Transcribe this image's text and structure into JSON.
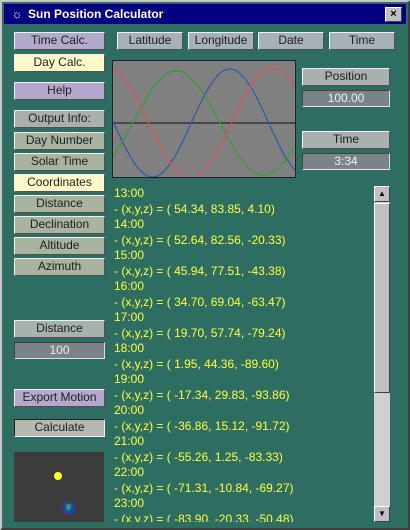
{
  "window": {
    "title": "Sun Position Calculator",
    "close_glyph": "×"
  },
  "left_menu": {
    "time_calc": "Time Calc.",
    "day_calc": "Day Calc.",
    "help": "Help",
    "output_info": "Output Info:",
    "items": [
      "Day Number",
      "Solar Time",
      "Coordinates",
      "Distance",
      "Declination",
      "Altitude",
      "Azimuth"
    ],
    "selected_item": "Coordinates",
    "distance_label": "Distance",
    "distance_value": "100",
    "export_motion": "Export Motion",
    "calculate": "Calculate"
  },
  "top_buttons": [
    "Latitude",
    "Longitude",
    "Date",
    "Time"
  ],
  "right_panel": {
    "position_label": "Position",
    "position_value": "100.00",
    "time_label": "Time",
    "time_value": "3:34"
  },
  "graph": {
    "series_colors": [
      "#2d5aa8",
      "#2ea02e",
      "#e05050"
    ],
    "axis_color": "#101010"
  },
  "output": {
    "lines": [
      "13:00",
      " - (x,y,z) = ( 54.34, 83.85, 4.10)",
      "14:00",
      " - (x,y,z) = ( 52.64, 82.56, -20.33)",
      "15:00",
      " - (x,y,z) = ( 45.94, 77.51, -43.38)",
      "16:00",
      " - (x,y,z) = ( 34.70, 69.04, -63.47)",
      "17:00",
      " - (x,y,z) = ( 19.70, 57.74, -79.24)",
      "18:00",
      " - (x,y,z) = ( 1.95, 44.36, -89.60)",
      "19:00",
      " - (x,y,z) = ( -17.34, 29.83, -93.86)",
      "20:00",
      " - (x,y,z) = ( -36.86, 15.12, -91.72)",
      "21:00",
      " - (x,y,z) = ( -55.26, 1.25, -83.33)",
      "22:00",
      " - (x,y,z) = ( -71.31, -10.84, -69.27)",
      "23:00",
      " - (x,y,z) = ( -83.90, -20.33, -50.48)"
    ],
    "text_color": "#ffff40"
  }
}
